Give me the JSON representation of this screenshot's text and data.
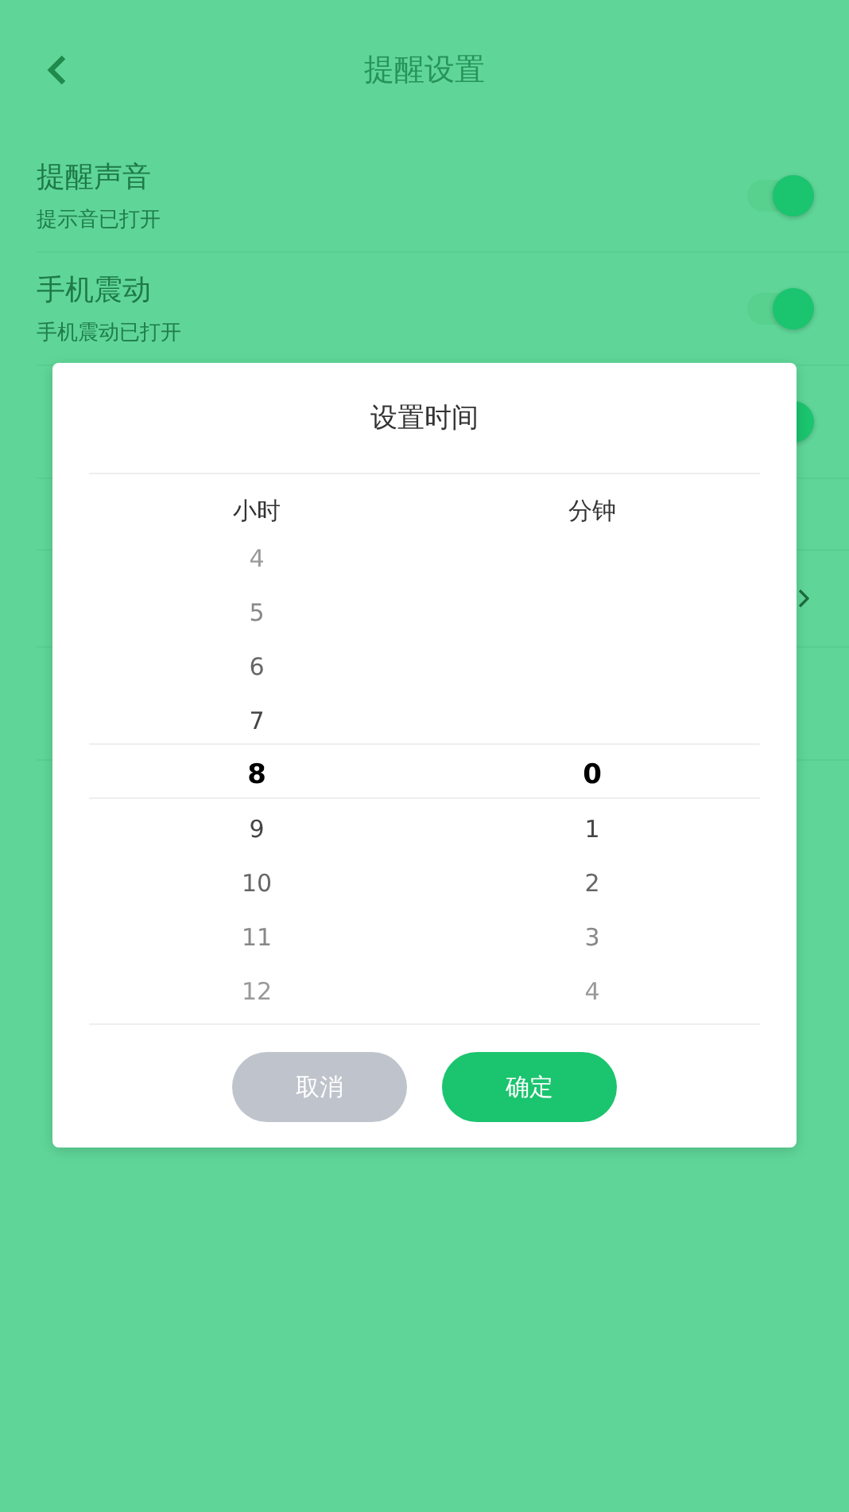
{
  "header": {
    "title": "提醒设置"
  },
  "settings": [
    {
      "kind": "toggle",
      "title": "提醒声音",
      "subtitle": "提示音已打开",
      "on": true
    },
    {
      "kind": "toggle",
      "title": "手机震动",
      "subtitle": "手机震动已打开",
      "on": true
    },
    {
      "kind": "toggle",
      "on": true
    },
    {
      "kind": "plain"
    },
    {
      "kind": "link"
    },
    {
      "kind": "tall"
    }
  ],
  "dialog": {
    "title": "设置时间",
    "columns": [
      {
        "label": "小时",
        "items": [
          {
            "value": "4",
            "selected": false
          },
          {
            "value": "5",
            "selected": false
          },
          {
            "value": "6",
            "selected": false
          },
          {
            "value": "7",
            "selected": false
          },
          {
            "value": "8",
            "selected": true
          },
          {
            "value": "9",
            "selected": false
          },
          {
            "value": "10",
            "selected": false
          },
          {
            "value": "11",
            "selected": false
          },
          {
            "value": "12",
            "selected": false
          }
        ]
      },
      {
        "label": "分钟",
        "items": [
          {
            "value": "0",
            "selected": true
          },
          {
            "value": "1",
            "selected": false
          },
          {
            "value": "2",
            "selected": false
          },
          {
            "value": "3",
            "selected": false
          },
          {
            "value": "4",
            "selected": false
          }
        ]
      }
    ],
    "buttons": [
      {
        "label": "取消",
        "kind": "cancel"
      },
      {
        "label": "确定",
        "kind": "confirm"
      }
    ]
  }
}
